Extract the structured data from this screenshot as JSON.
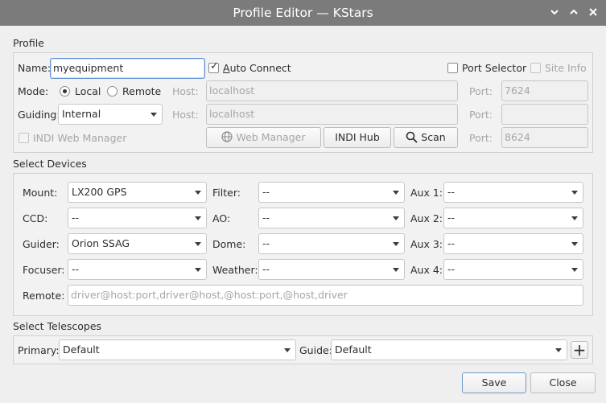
{
  "window": {
    "title": "Profile Editor — KStars"
  },
  "profile": {
    "section_title": "Profile",
    "name_label": "Name:",
    "name_value": "myequipment",
    "auto_connect_label": "Auto Connect",
    "auto_connect_checked": true,
    "port_selector_label": "Port Selector",
    "site_info_label": "Site Info",
    "mode_label": "Mode:",
    "mode_local": "Local",
    "mode_remote": "Remote",
    "mode_selected": "Local",
    "host_label": "Host:",
    "host_value": "localhost",
    "port_label": "Port:",
    "port_value": "7624",
    "guiding_label": "Guiding:",
    "guiding_value": "Internal",
    "guide_host_value": "localhost",
    "guide_port_value": "",
    "indi_web_manager_label": "INDI Web Manager",
    "web_manager_button": "Web Manager",
    "indi_hub_button": "INDI Hub",
    "scan_button": "Scan",
    "web_port_value": "8624"
  },
  "devices": {
    "section_title": "Select Devices",
    "rows": [
      {
        "label": "Mount:",
        "value": "LX200 GPS",
        "label2": "Filter:",
        "value2": "--",
        "label3": "Aux 1:",
        "value3": "--"
      },
      {
        "label": "CCD:",
        "value": "--",
        "label2": "AO:",
        "value2": "--",
        "label3": "Aux 2:",
        "value3": "--"
      },
      {
        "label": "Guider:",
        "value": "Orion SSAG",
        "label2": "Dome:",
        "value2": "--",
        "label3": "Aux 3:",
        "value3": "--"
      },
      {
        "label": "Focuser:",
        "value": "--",
        "label2": "Weather:",
        "value2": "--",
        "label3": "Aux 4:",
        "value3": "--"
      }
    ],
    "remote_label": "Remote:",
    "remote_placeholder": "driver@host:port,driver@host,@host:port,@host,driver"
  },
  "telescopes": {
    "section_title": "Select Telescopes",
    "primary_label": "Primary:",
    "primary_value": "Default",
    "guide_label": "Guide:",
    "guide_value": "Default",
    "add_symbol": "+"
  },
  "footer": {
    "save_label": "Save",
    "close_label": "Close"
  },
  "colors": {
    "titlebar": "#7b7b7b",
    "focus_border": "#5c8ed6"
  },
  "icons": {
    "globe": "globe-icon",
    "search": "search-icon"
  }
}
